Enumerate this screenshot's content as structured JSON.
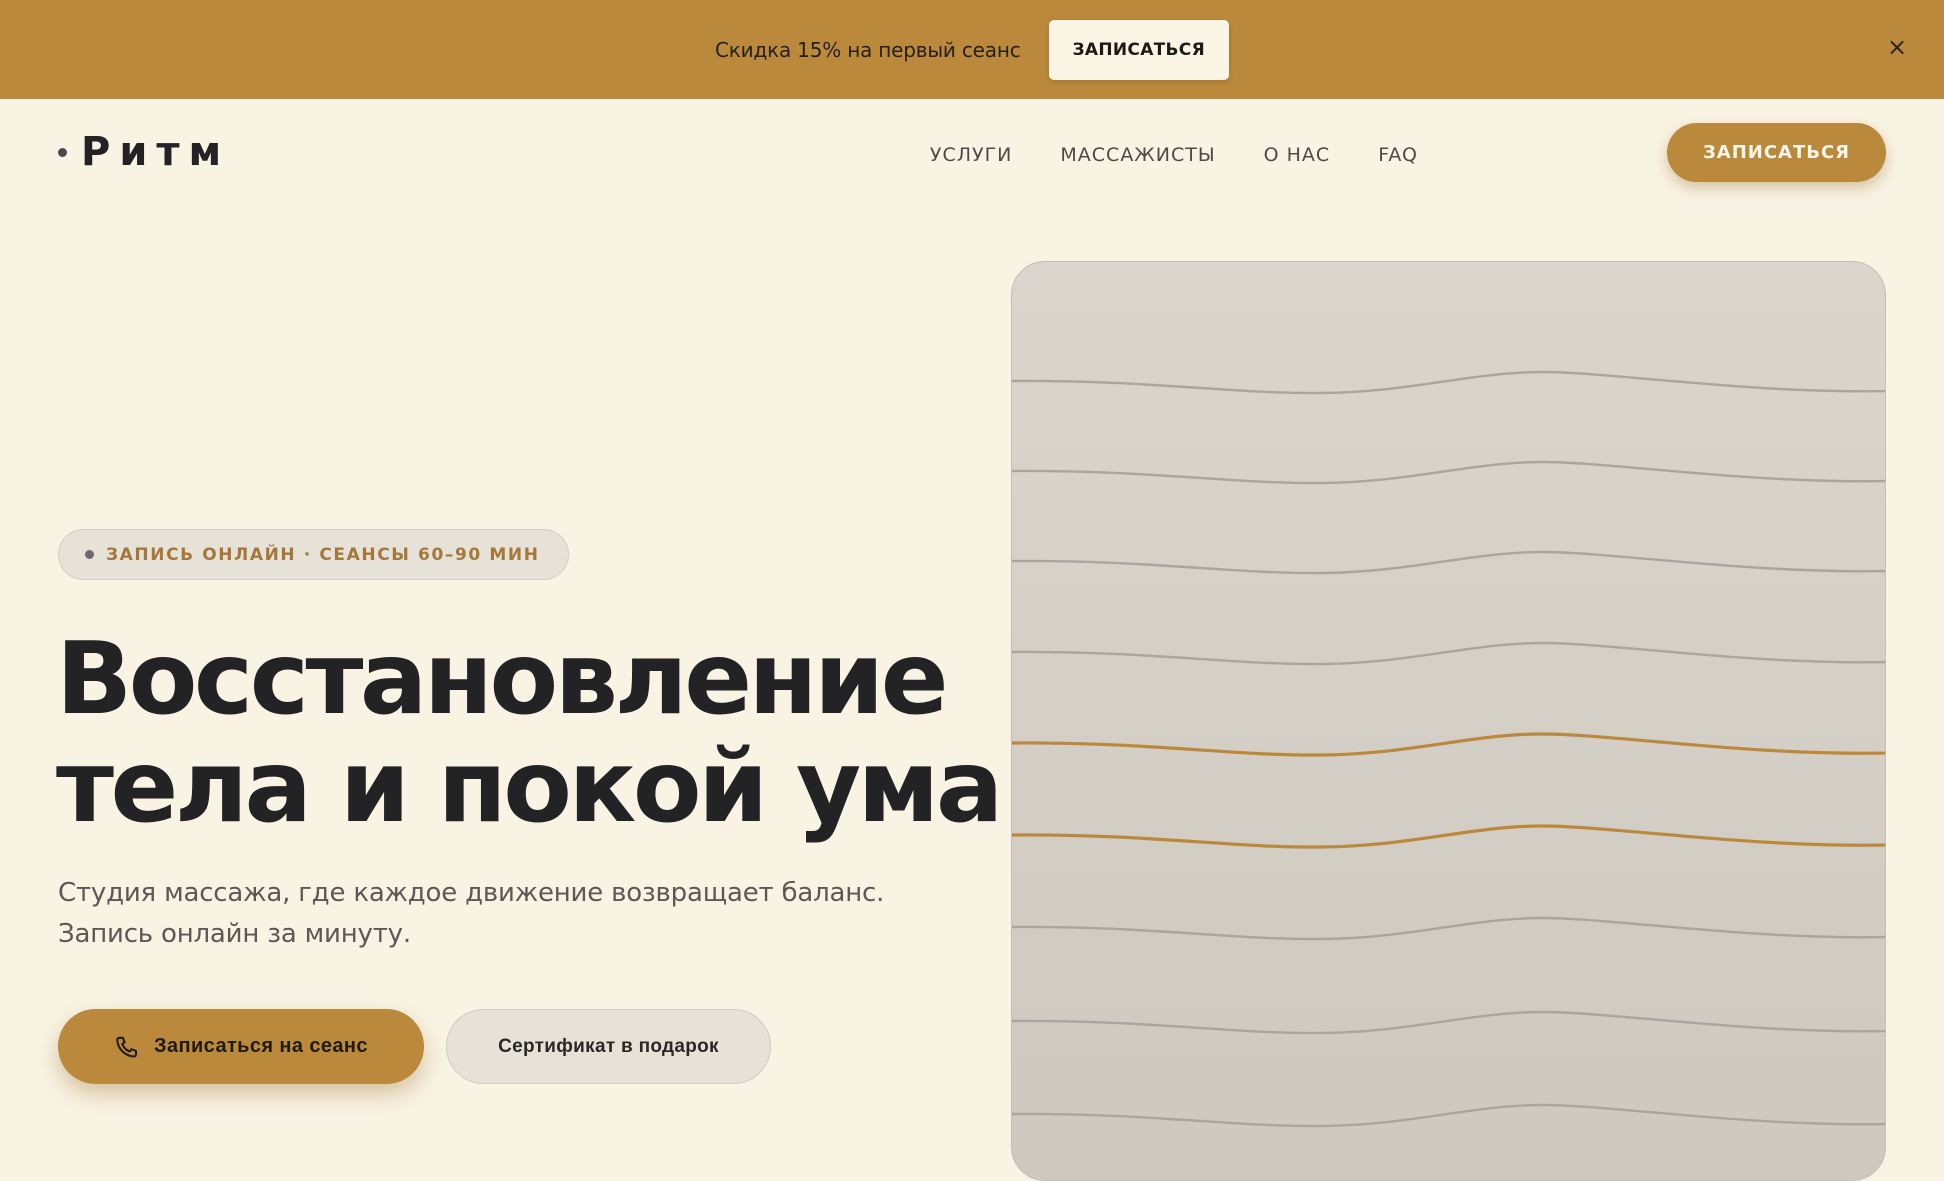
{
  "promo": {
    "text": "Скидка 15% на первый сеанс",
    "button_label": "ЗАПИСАТЬСЯ",
    "close_symbol": "×"
  },
  "header": {
    "logo": "Ритм",
    "nav": [
      "УСЛУГИ",
      "МАССАЖИСТЫ",
      "О НАС",
      "FAQ"
    ],
    "cta_label": "ЗАПИСАТЬСЯ"
  },
  "hero": {
    "badge": "ЗАПИСЬ ОНЛАЙН · СЕАНСЫ 60–90 МИН",
    "title_line1": "Восстановление",
    "title_line2": "тела и покой ума",
    "subtitle": "Студия массажа, где каждое движение возвращает баланс. Запись онлайн за минуту.",
    "primary_button": "Записаться на сеанс",
    "secondary_button": "Сертификат в подарок"
  },
  "icons": {
    "primary_button_icon": "phone-icon",
    "close_icon": "close-icon",
    "visual": "wave-lines-illustration"
  },
  "colors": {
    "accent": "#bb893b",
    "background": "#f9f3e3",
    "text": "#232326",
    "visual_line": "#a9a59f"
  }
}
